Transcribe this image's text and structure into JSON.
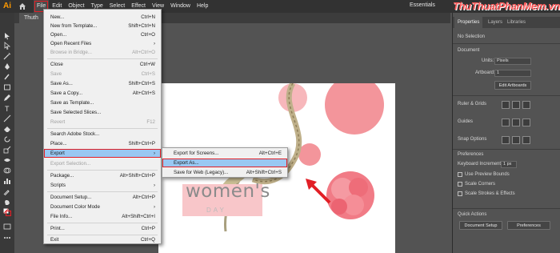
{
  "app": {
    "logo": "Ai",
    "document_tab": "Thuth"
  },
  "menubar": {
    "items": [
      "File",
      "Edit",
      "Object",
      "Type",
      "Select",
      "Effect",
      "View",
      "Window",
      "Help"
    ],
    "workspace": "Essentials",
    "brand": "ThuThuatPhanMem.vn"
  },
  "file_menu": [
    {
      "label": "New...",
      "shortcut": "Ctrl+N"
    },
    {
      "label": "New from Template...",
      "shortcut": "Shift+Ctrl+N"
    },
    {
      "label": "Open...",
      "shortcut": "Ctrl+O"
    },
    {
      "label": "Open Recent Files",
      "shortcut": "›"
    },
    {
      "label": "Browse in Bridge...",
      "shortcut": "Alt+Ctrl+O"
    },
    {
      "label": "Close",
      "shortcut": "Ctrl+W"
    },
    {
      "label": "Save",
      "shortcut": "Ctrl+S"
    },
    {
      "label": "Save As...",
      "shortcut": "Shift+Ctrl+S"
    },
    {
      "label": "Save a Copy...",
      "shortcut": "Alt+Ctrl+S"
    },
    {
      "label": "Save as Template...",
      "shortcut": ""
    },
    {
      "label": "Save Selected Slices...",
      "shortcut": ""
    },
    {
      "label": "Revert",
      "shortcut": "F12"
    },
    {
      "label": "Search Adobe Stock...",
      "shortcut": ""
    },
    {
      "label": "Place...",
      "shortcut": "Shift+Ctrl+P"
    },
    {
      "label": "Export",
      "shortcut": "›"
    },
    {
      "label": "Export Selection...",
      "shortcut": ""
    },
    {
      "label": "Package...",
      "shortcut": "Alt+Shift+Ctrl+P"
    },
    {
      "label": "Scripts",
      "shortcut": "›"
    },
    {
      "label": "Document Setup...",
      "shortcut": "Alt+Ctrl+P"
    },
    {
      "label": "Document Color Mode",
      "shortcut": "›"
    },
    {
      "label": "File Info...",
      "shortcut": "Alt+Shift+Ctrl+I"
    },
    {
      "label": "Print...",
      "shortcut": "Ctrl+P"
    },
    {
      "label": "Exit",
      "shortcut": "Ctrl+Q"
    }
  ],
  "export_submenu": [
    {
      "label": "Export for Screens...",
      "shortcut": "Alt+Ctrl+E"
    },
    {
      "label": "Export As...",
      "shortcut": ""
    },
    {
      "label": "Save for Web (Legacy)...",
      "shortcut": "Alt+Shift+Ctrl+S"
    }
  ],
  "artwork": {
    "title": "women's",
    "subtitle": "DAY"
  },
  "panel": {
    "tabs": [
      "Properties",
      "Layers",
      "Libraries"
    ],
    "no_selection": "No Selection",
    "document": "Document",
    "units_label": "Units:",
    "units_value": "Pixels",
    "artboard_label": "Artboard:",
    "artboard_value": "1",
    "edit_artboards": "Edit Artboards",
    "ruler_grids": "Ruler & Grids",
    "guides": "Guides",
    "snap_options": "Snap Options",
    "preferences": "Preferences",
    "keyboard_increment_label": "Keyboard Increment:",
    "keyboard_increment_value": "1 px",
    "use_preview_bounds": "Use Preview Bounds",
    "scale_corners": "Scale Corners",
    "scale_strokes": "Scale Strokes & Effects",
    "quick_actions": "Quick Actions",
    "document_setup": "Document Setup",
    "preferences_btn": "Preferences"
  },
  "colors": {
    "accent_red": "#e21f26",
    "highlight": "#99c8f2",
    "petal": "#f3959b"
  }
}
